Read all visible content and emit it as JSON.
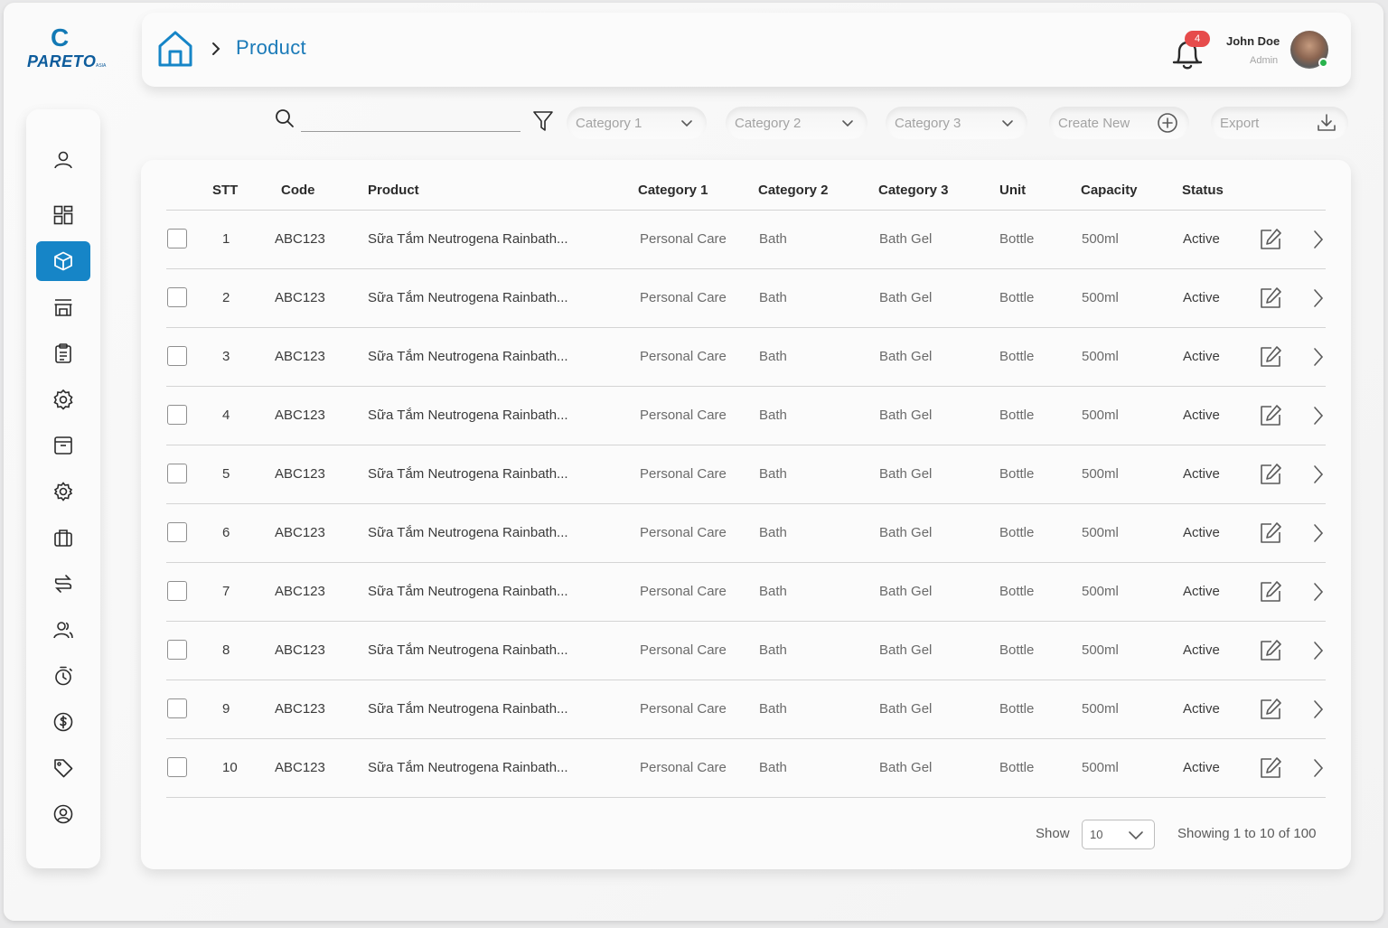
{
  "brand": {
    "logo_text": "PARETO",
    "logo_suffix": "ASIA"
  },
  "header": {
    "breadcrumb_title": "Product",
    "notification_count": "4",
    "user_name": "John Doe",
    "user_role": "Admin"
  },
  "sidebar": {
    "items": [
      {
        "icon": "user-icon"
      },
      {
        "icon": "dashboard-icon"
      },
      {
        "icon": "product-box-icon",
        "active": true
      },
      {
        "icon": "store-icon"
      },
      {
        "icon": "clipboard-icon"
      },
      {
        "icon": "gear-badge-icon"
      },
      {
        "icon": "archive-icon"
      },
      {
        "icon": "settings-icon"
      },
      {
        "icon": "briefcase-icon"
      },
      {
        "icon": "transfer-icon"
      },
      {
        "icon": "users-icon"
      },
      {
        "icon": "timer-icon"
      },
      {
        "icon": "dollar-icon"
      },
      {
        "icon": "tag-icon"
      },
      {
        "icon": "support-icon"
      }
    ]
  },
  "toolbar": {
    "search_placeholder": "",
    "category1": "Category 1",
    "category2": "Category 2",
    "category3": "Category 3",
    "create_new": "Create New",
    "export": "Export"
  },
  "table": {
    "columns": [
      "STT",
      "Code",
      "Product",
      "Category 1",
      "Category 2",
      "Category 3",
      "Unit",
      "Capacity",
      "Status"
    ],
    "rows": [
      {
        "stt": "1",
        "code": "ABC123",
        "product": "Sữa Tắm Neutrogena Rainbath...",
        "cat1": "Personal Care",
        "cat2": "Bath",
        "cat3": "Bath Gel",
        "unit": "Bottle",
        "capacity": "500ml",
        "status": "Active"
      },
      {
        "stt": "2",
        "code": "ABC123",
        "product": "Sữa Tắm Neutrogena Rainbath...",
        "cat1": "Personal Care",
        "cat2": "Bath",
        "cat3": "Bath Gel",
        "unit": "Bottle",
        "capacity": "500ml",
        "status": "Active"
      },
      {
        "stt": "3",
        "code": "ABC123",
        "product": "Sữa Tắm Neutrogena Rainbath...",
        "cat1": "Personal Care",
        "cat2": "Bath",
        "cat3": "Bath Gel",
        "unit": "Bottle",
        "capacity": "500ml",
        "status": "Active"
      },
      {
        "stt": "4",
        "code": "ABC123",
        "product": "Sữa Tắm Neutrogena Rainbath...",
        "cat1": "Personal Care",
        "cat2": "Bath",
        "cat3": "Bath Gel",
        "unit": "Bottle",
        "capacity": "500ml",
        "status": "Active"
      },
      {
        "stt": "5",
        "code": "ABC123",
        "product": "Sữa Tắm Neutrogena Rainbath...",
        "cat1": "Personal Care",
        "cat2": "Bath",
        "cat3": "Bath Gel",
        "unit": "Bottle",
        "capacity": "500ml",
        "status": "Active"
      },
      {
        "stt": "6",
        "code": "ABC123",
        "product": "Sữa Tắm Neutrogena Rainbath...",
        "cat1": "Personal Care",
        "cat2": "Bath",
        "cat3": "Bath Gel",
        "unit": "Bottle",
        "capacity": "500ml",
        "status": "Active"
      },
      {
        "stt": "7",
        "code": "ABC123",
        "product": "Sữa Tắm Neutrogena Rainbath...",
        "cat1": "Personal Care",
        "cat2": "Bath",
        "cat3": "Bath Gel",
        "unit": "Bottle",
        "capacity": "500ml",
        "status": "Active"
      },
      {
        "stt": "8",
        "code": "ABC123",
        "product": "Sữa Tắm Neutrogena Rainbath...",
        "cat1": "Personal Care",
        "cat2": "Bath",
        "cat3": "Bath Gel",
        "unit": "Bottle",
        "capacity": "500ml",
        "status": "Active"
      },
      {
        "stt": "9",
        "code": "ABC123",
        "product": "Sữa Tắm Neutrogena Rainbath...",
        "cat1": "Personal Care",
        "cat2": "Bath",
        "cat3": "Bath Gel",
        "unit": "Bottle",
        "capacity": "500ml",
        "status": "Active"
      },
      {
        "stt": "10",
        "code": "ABC123",
        "product": "Sữa Tắm Neutrogena Rainbath...",
        "cat1": "Personal Care",
        "cat2": "Bath",
        "cat3": "Bath Gel",
        "unit": "Bottle",
        "capacity": "500ml",
        "status": "Active"
      }
    ]
  },
  "footer": {
    "show_label": "Show",
    "page_size": "10",
    "showing_text": "Showing 1 to 10 of 100"
  },
  "colors": {
    "accent": "#1685c7",
    "title_blue": "#1a7ab8",
    "badge": "#e64b4b",
    "online": "#29b34d"
  }
}
